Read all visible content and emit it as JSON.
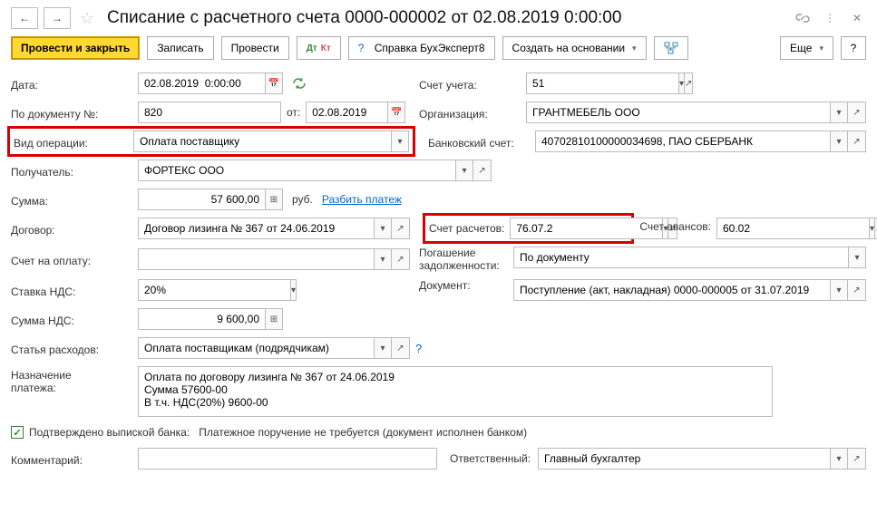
{
  "title": "Списание с расчетного счета 0000-000002 от 02.08.2019 0:00:00",
  "toolbar": {
    "post_close": "Провести и закрыть",
    "save": "Записать",
    "post": "Провести",
    "dtKt": "Дт Кт",
    "help": "Справка БухЭксперт8",
    "create_on": "Создать на основании",
    "more": "Еще"
  },
  "labels": {
    "date": "Дата:",
    "doc_no": "По документу №:",
    "from": "от:",
    "op_type": "Вид операции:",
    "recipient": "Получатель:",
    "amount": "Сумма:",
    "currency": "руб.",
    "split": "Разбить платеж",
    "contract": "Договор:",
    "invoice": "Счет на оплату:",
    "vat_rate": "Ставка НДС:",
    "vat_sum": "Сумма НДС:",
    "expense": "Статья расходов:",
    "purpose": "Назначение платежа:",
    "confirmed": "Подтверждено выпиской банка:",
    "payorder_not_req": "Платежное поручение не требуется (документ исполнен банком)",
    "comment": "Комментарий:",
    "account": "Счет учета:",
    "org": "Организация:",
    "bank_acct": "Банковский счет:",
    "settle_acct": "Счет расчетов:",
    "advance_acct": "Счет авансов:",
    "debt": "Погашение задолженности:",
    "document": "Документ:",
    "responsible": "Ответственный:"
  },
  "values": {
    "date": "02.08.2019  0:00:00",
    "doc_no": "820",
    "doc_date": "02.08.2019",
    "op_type": "Оплата поставщику",
    "recipient": "ФОРТЕКС ООО",
    "amount": "57 600,00",
    "contract": "Договор лизинга № 367 от 24.06.2019",
    "vat_rate": "20%",
    "vat_sum": "9 600,00",
    "expense": "Оплата поставщикам (подрядчикам)",
    "purpose": "Оплата по договору лизинга № 367 от 24.06.2019\nСумма 57600-00\nВ т.ч. НДС(20%) 9600-00",
    "account": "51",
    "org": "ГРАНТМЕБЕЛЬ ООО",
    "bank_acct": "40702810100000034698, ПАО СБЕРБАНК",
    "settle_acct": "76.07.2",
    "advance_acct": "60.02",
    "debt": "По документу",
    "document": "Поступление (акт, накладная) 0000-000005 от 31.07.2019",
    "responsible": "Главный бухгалтер"
  }
}
